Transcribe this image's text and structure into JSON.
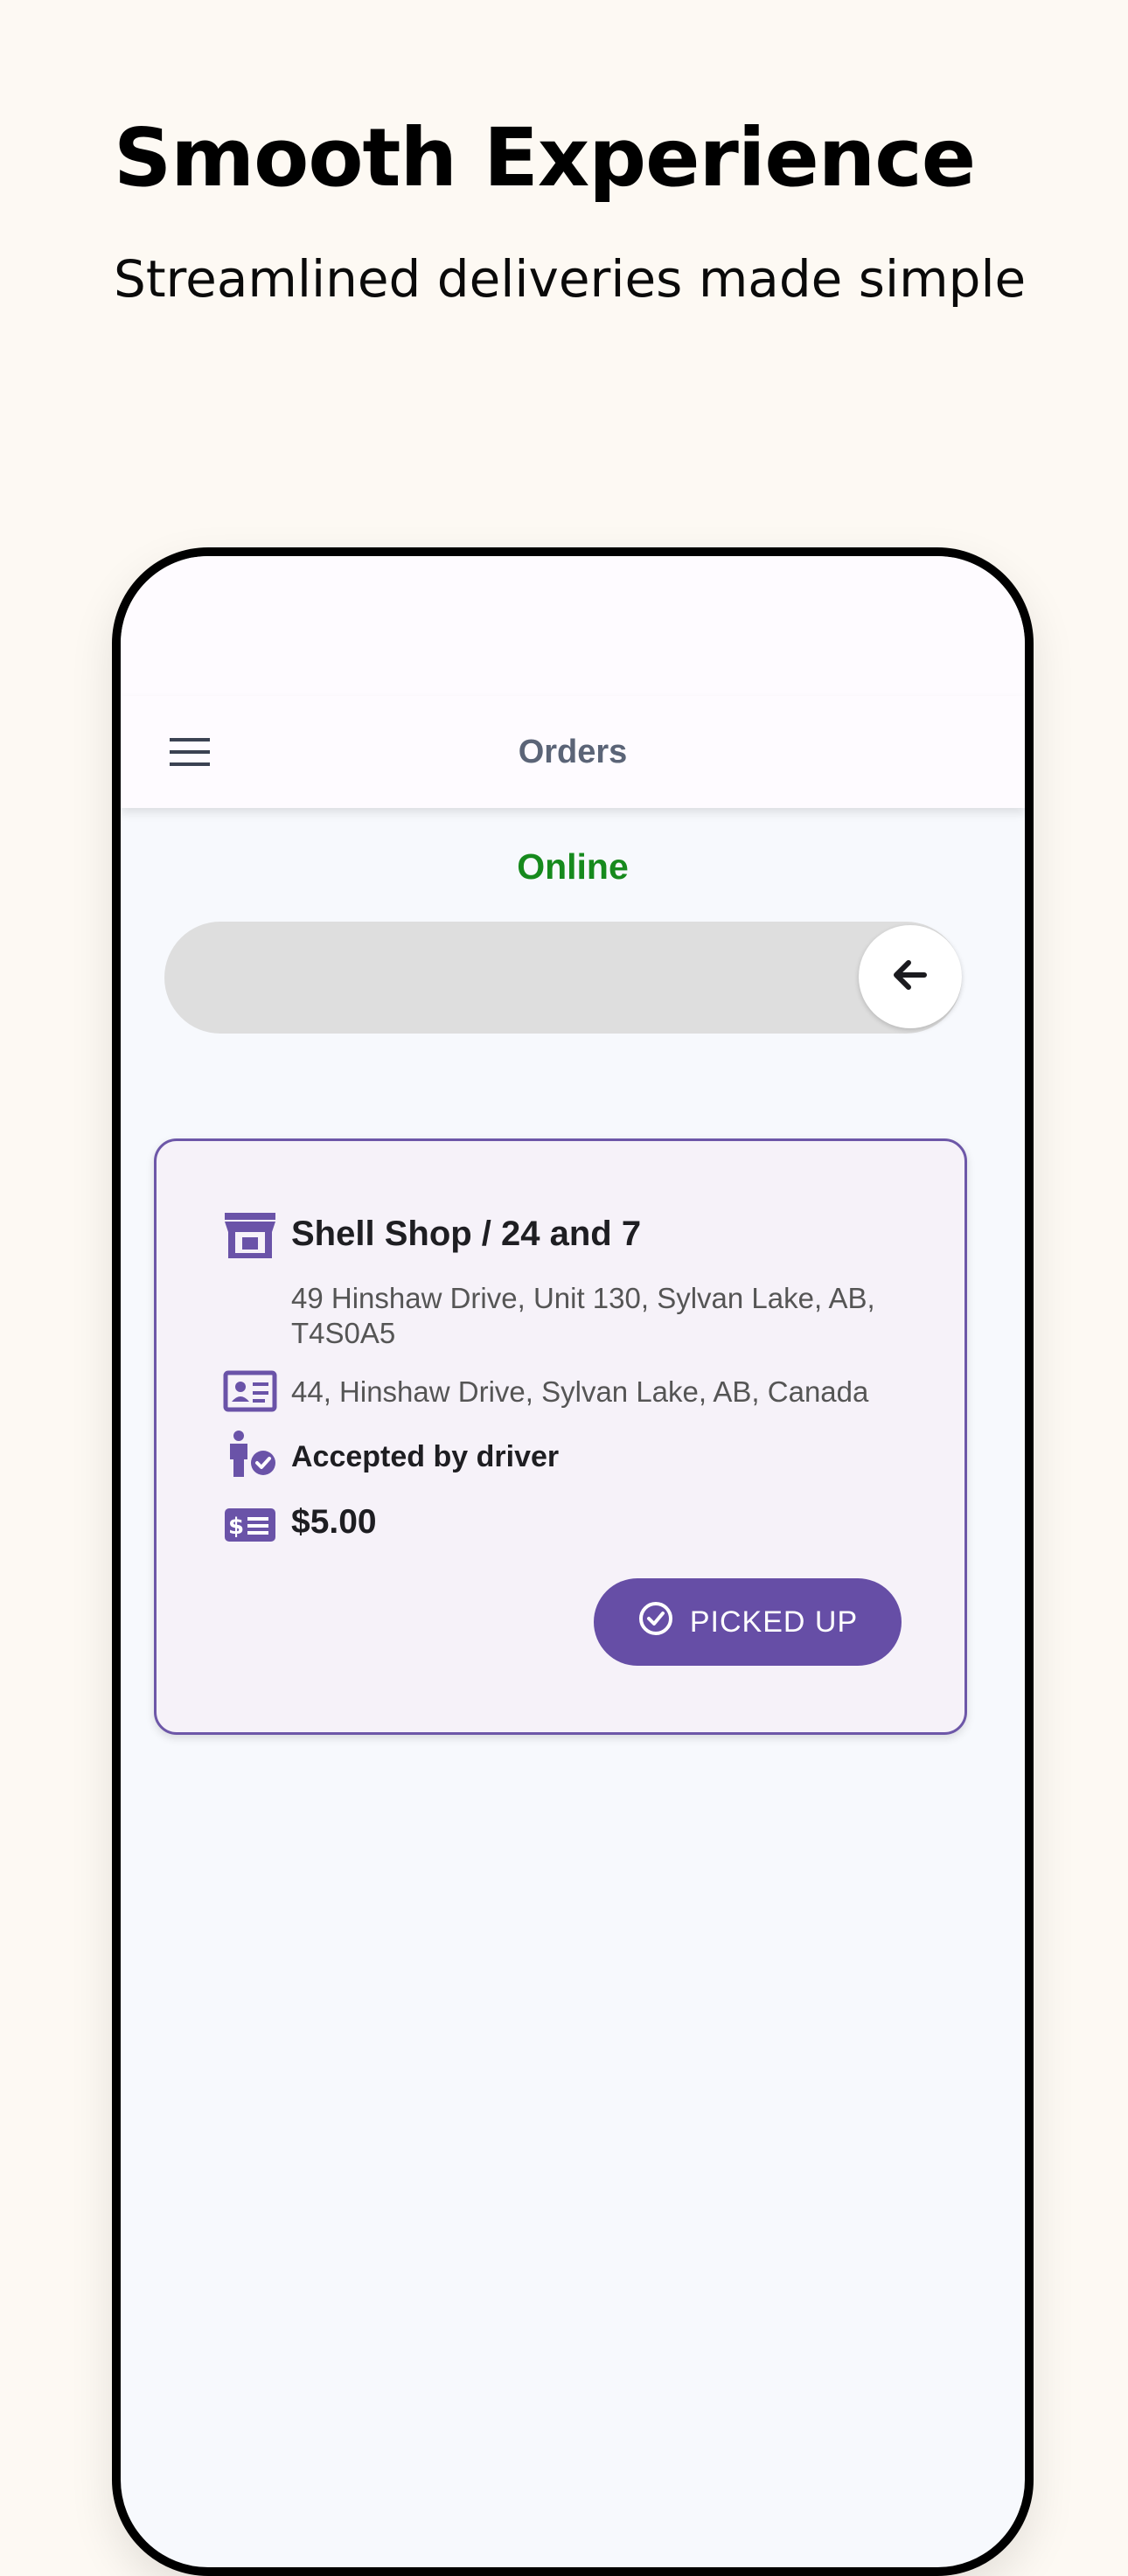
{
  "promo": {
    "headline": "Smooth Experience",
    "subhead": "Streamlined deliveries made simple"
  },
  "app_bar": {
    "title": "Orders"
  },
  "availability": {
    "status": "Online"
  },
  "order": {
    "shop_name": "Shell Shop / 24 and 7",
    "shop_address": "49 Hinshaw Drive, Unit 130, Sylvan Lake, AB, T4S0A5",
    "dest_address": "44, Hinshaw Drive, Sylvan Lake, AB, Canada",
    "status": "Accepted by driver",
    "price": "$5.00",
    "action_label": "PICKED UP"
  },
  "colors": {
    "accent": "#664ea6",
    "online": "#168a1d",
    "background": "#fdf9f3"
  },
  "icons": {
    "menu": "menu-icon",
    "slider": "arrow-left-icon",
    "shop": "storefront-icon",
    "destination": "contact-card-icon",
    "status": "person-check-icon",
    "price": "money-bill-icon",
    "action": "check-circle-icon"
  }
}
